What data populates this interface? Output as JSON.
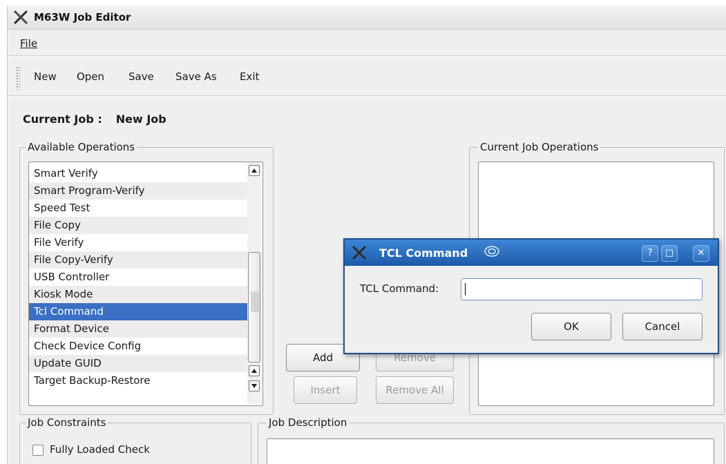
{
  "window": {
    "title": "M63W Job Editor"
  },
  "menu": {
    "file_label": "File"
  },
  "toolbar": {
    "items": [
      "New",
      "Open",
      "Save",
      "Save As",
      "Exit"
    ]
  },
  "current_job": {
    "label": "Current Job :",
    "value": "New Job"
  },
  "available_operations": {
    "title": "Available Operations",
    "items": [
      "Smart Verify",
      "Smart Program-Verify",
      "Speed Test",
      "File Copy",
      "File Verify",
      "File Copy-Verify",
      "USB Controller",
      "Kiosk Mode",
      "Tcl Command",
      "Format Device",
      "Check Device Config",
      "Update GUID",
      "Target Backup-Restore"
    ],
    "selected": "Tcl Command"
  },
  "current_job_operations": {
    "title": "Current Job Operations"
  },
  "buttons": {
    "add": "Add",
    "remove": "Remove",
    "insert": "Insert",
    "remove_all": "Remove All"
  },
  "job_constraints": {
    "title": "Job Constraints",
    "fully_loaded_check": "Fully Loaded Check"
  },
  "job_description": {
    "title": "Job Description"
  },
  "dialog": {
    "title": "TCL Command",
    "field_label": "TCL Command:",
    "field_value": "",
    "ok": "OK",
    "cancel": "Cancel",
    "help": "?",
    "maximize": "□",
    "close": "✕"
  }
}
